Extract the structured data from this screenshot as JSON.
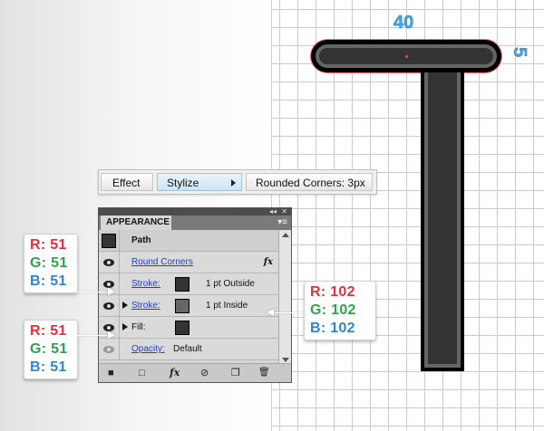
{
  "canvas": {
    "width_label": "40",
    "height_label": "5",
    "stroke_inner_color": "#666666",
    "fill_color": "#333333",
    "stroke_outer_color": "#000000",
    "selection_color": "#ff6b6b"
  },
  "menu": {
    "effect": "Effect",
    "stylize": "Stylize",
    "rounded": "Rounded Corners: 3px"
  },
  "panel": {
    "tab": "APPEARANCE",
    "collapse_glyph": "◂◂",
    "close_glyph": "✕",
    "menu_glyph": "▾≡",
    "rows": {
      "path": "Path",
      "round_corners": "Round Corners",
      "fx": "fx",
      "stroke1_label": "Stroke:",
      "stroke1_value": "1 pt  Outside",
      "stroke2_label": "Stroke:",
      "stroke2_value": "1 pt  Inside",
      "fill_label": "Fill:",
      "opacity_label": "Opacity:",
      "opacity_value": "Default"
    },
    "footer": {
      "square": "■",
      "empty_square": "□",
      "fx": "fx",
      "clear": "⊘",
      "duplicate": "❐",
      "trash": "🗑"
    }
  },
  "callouts": {
    "stroke_outer": {
      "r": "R: 51",
      "g": "G: 51",
      "b": "B: 51"
    },
    "fill": {
      "r": "R: 51",
      "g": "G: 51",
      "b": "B: 51"
    },
    "stroke_inner": {
      "r": "R: 102",
      "g": "G: 102",
      "b": "B: 102"
    }
  }
}
